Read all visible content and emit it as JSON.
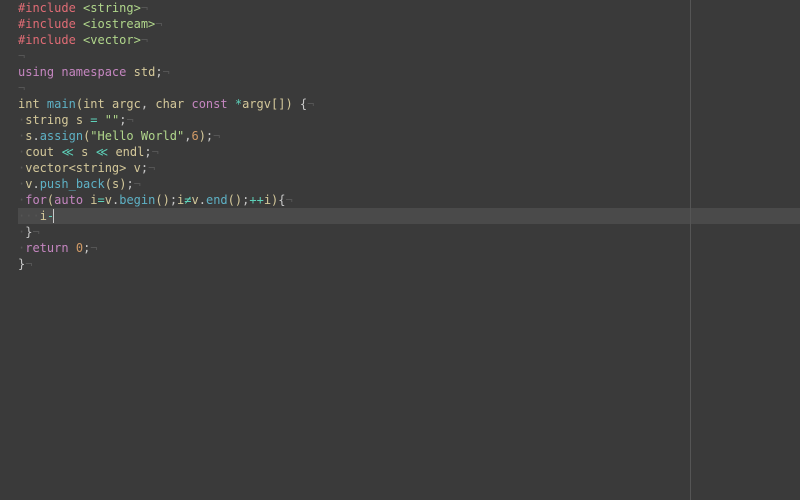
{
  "code": {
    "line1": {
      "preproc": "#include",
      "space": " ",
      "header": "<string>",
      "eol": "¬"
    },
    "line2": {
      "preproc": "#include",
      "space": " ",
      "header": "<iostream>",
      "eol": "¬"
    },
    "line3": {
      "preproc": "#include",
      "space": " ",
      "header": "<vector>",
      "eol": "¬"
    },
    "line4": {
      "eol": "¬"
    },
    "line5": {
      "kw1": "using",
      "space1": " ",
      "kw2": "namespace",
      "space2": " ",
      "ns": "std",
      "semi": ";",
      "eol": "¬"
    },
    "line6": {
      "eol": "¬"
    },
    "line7": {
      "type1": "int",
      "space1": " ",
      "func": "main",
      "lparen": "(",
      "type2": "int",
      "space2": " ",
      "arg1": "argc",
      "comma": ", ",
      "type3": "char",
      "space3": " ",
      "kw": "const",
      "space4": " ",
      "star": "*",
      "arg2": "argv",
      "brackets": "[]",
      "rparen": ")",
      "space5": " ",
      "brace": "{",
      "eol": "¬"
    },
    "line8": {
      "indent": "·",
      "type": "string",
      "space": " ",
      "var": "s",
      "space2": " ",
      "eq": "=",
      "space3": " ",
      "str": "\"\"",
      "semi": ";",
      "eol": "¬"
    },
    "line9": {
      "indent": "·",
      "var": "s",
      "dot": ".",
      "method": "assign",
      "lparen": "(",
      "str": "\"Hello World\"",
      "comma": ",",
      "num": "6",
      "rparen": ")",
      "semi": ";",
      "eol": "¬"
    },
    "line10": {
      "indent": "·",
      "cout": "cout",
      "space1": " ",
      "op1": "≪",
      "space2": " ",
      "var": "s",
      "space3": " ",
      "op2": "≪",
      "space4": " ",
      "endl": "endl",
      "semi": ";",
      "eol": "¬"
    },
    "line11": {
      "indent": "·",
      "type": "vector<string>",
      "space": " ",
      "var": "v",
      "semi": ";",
      "eol": "¬"
    },
    "line12": {
      "indent": "·",
      "var": "v",
      "dot": ".",
      "method": "push_back",
      "lparen": "(",
      "arg": "s",
      "rparen": ")",
      "semi": ";",
      "eol": "¬"
    },
    "line13": {
      "indent": "·",
      "kw": "for",
      "lparen": "(",
      "auto": "auto",
      "space": " ",
      "var": "i",
      "eq": "=",
      "obj": "v",
      "dot1": ".",
      "begin": "begin",
      "p1": "()",
      "semi1": ";",
      "var2": "i",
      "neq": "≠",
      "obj2": "v",
      "dot2": ".",
      "end": "end",
      "p2": "()",
      "semi2": ";",
      "inc": "++",
      "var3": "i",
      "rparen": ")",
      "brace": "{",
      "eol": "¬"
    },
    "line14": {
      "indent": "···",
      "var": "i",
      "dash": "-",
      "eol": ""
    },
    "line15": {
      "indent": "·",
      "brace": "}",
      "eol": "¬"
    },
    "line16": {
      "indent": "·",
      "kw": "return",
      "space": " ",
      "num": "0",
      "semi": ";",
      "eol": "¬"
    },
    "line17": {
      "brace": "}",
      "eol": "¬"
    }
  }
}
